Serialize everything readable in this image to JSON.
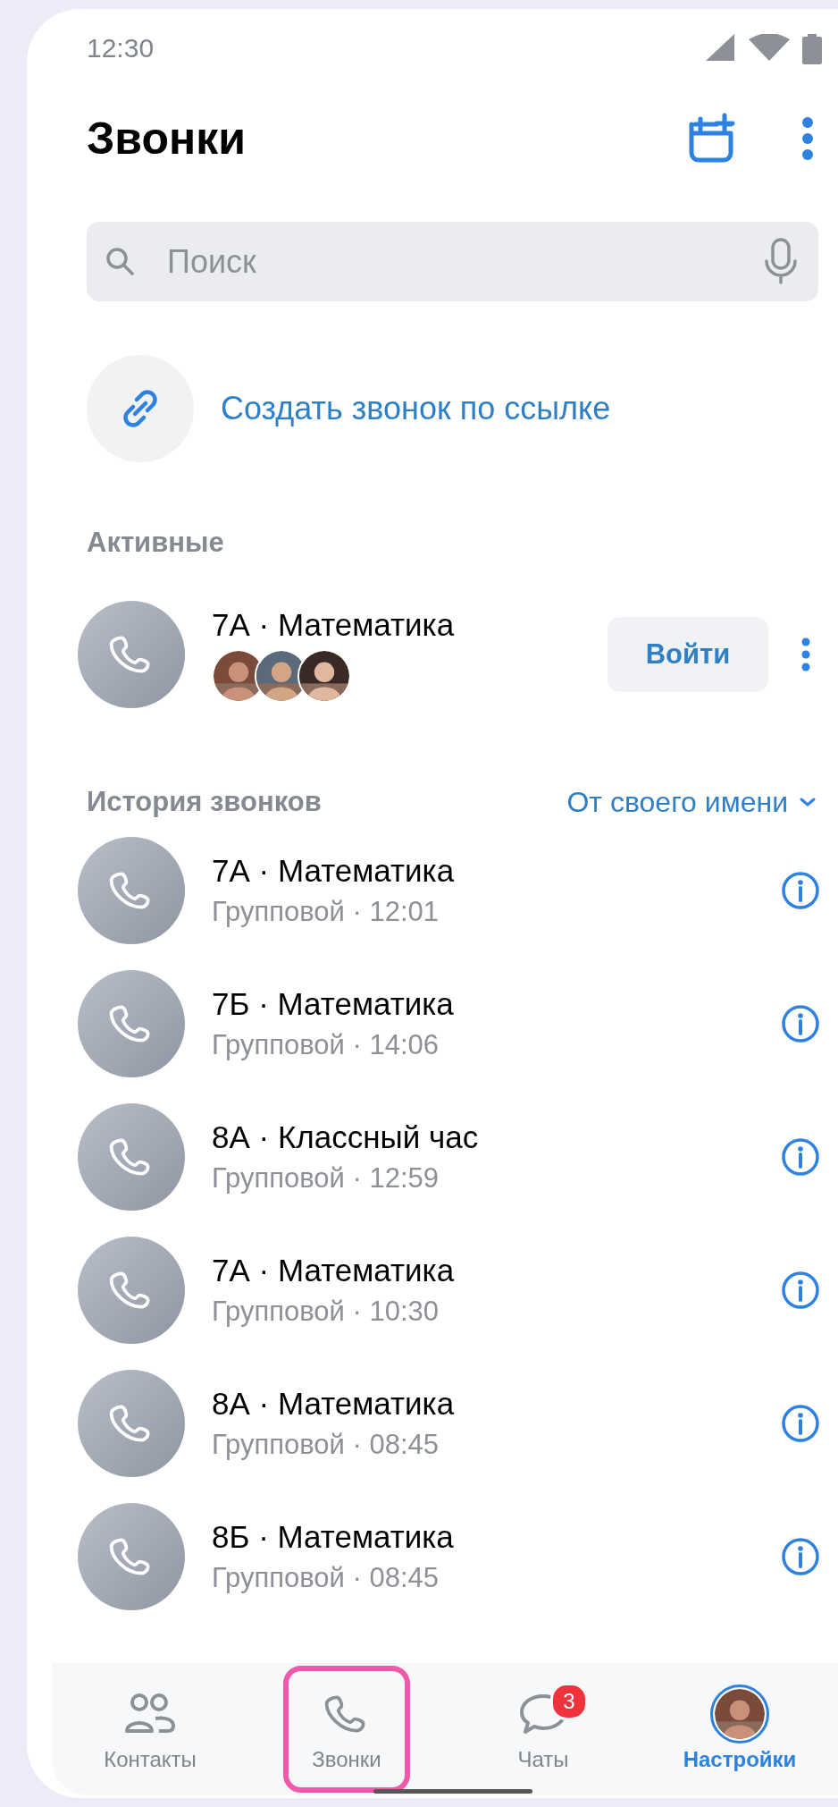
{
  "status_bar": {
    "time": "12:30"
  },
  "header": {
    "title": "Звонки"
  },
  "search": {
    "placeholder": "Поиск"
  },
  "create_link": {
    "label": "Создать звонок по ссылке"
  },
  "active": {
    "title": "Активные",
    "calls": [
      {
        "name": "7А · Математика",
        "button": "Войти"
      }
    ]
  },
  "history": {
    "title": "История звонков",
    "filter": "От своего имени",
    "calls": [
      {
        "name": "7А · Математика",
        "details": "Групповой · 12:01"
      },
      {
        "name": "7Б · Математика",
        "details": "Групповой · 14:06"
      },
      {
        "name": "8А · Классный час",
        "details": "Групповой · 12:59"
      },
      {
        "name": "7А · Математика",
        "details": "Групповой · 10:30"
      },
      {
        "name": "8А · Математика",
        "details": "Групповой · 08:45"
      },
      {
        "name": "8Б · Математика",
        "details": "Групповой · 08:45"
      }
    ]
  },
  "nav": [
    {
      "label": "Контакты",
      "kind": "contacts",
      "selected": false,
      "highlighted": false
    },
    {
      "label": "Звонки",
      "kind": "phone",
      "selected": false,
      "highlighted": true
    },
    {
      "label": "Чаты",
      "kind": "chat",
      "badge": "3",
      "selected": false,
      "highlighted": false
    },
    {
      "label": "Настройки",
      "kind": "avatar",
      "selected": true,
      "highlighted": false
    }
  ]
}
